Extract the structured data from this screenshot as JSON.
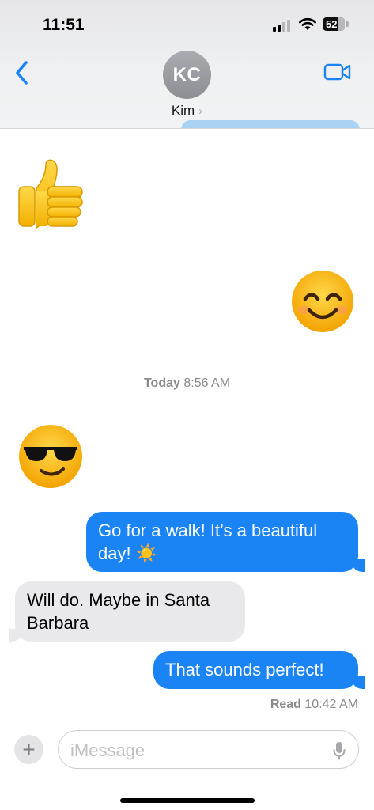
{
  "status_bar": {
    "time": "11:51",
    "battery_level": "52"
  },
  "header": {
    "avatar_initials": "KC",
    "contact_name": "Kim",
    "chevron": "›",
    "icons": [
      "back-chevron-icon",
      "facetime-video-icon"
    ],
    "accent_color": "#1a84f5"
  },
  "thread": {
    "timestamp": {
      "day": "Today",
      "time": "8:56 AM"
    },
    "messages": [
      {
        "direction": "incoming",
        "type": "emoji",
        "emoji": "👍"
      },
      {
        "direction": "outgoing",
        "type": "emoji",
        "emoji": "😊"
      },
      {
        "direction": "incoming",
        "type": "emoji",
        "emoji": "😎"
      },
      {
        "direction": "outgoing",
        "type": "text",
        "line1": "Go for a walk! It’s a beautiful",
        "line2": "day! ☀️"
      },
      {
        "direction": "incoming",
        "type": "text",
        "line1": "Will do. Maybe in Santa",
        "line2": "Barbara"
      },
      {
        "direction": "outgoing",
        "type": "text",
        "line1": "That sounds perfect!"
      }
    ],
    "read_receipt": {
      "label": "Read",
      "time": "10:42 AM"
    }
  },
  "composer": {
    "plus_label": "+",
    "placeholder": "iMessage"
  }
}
